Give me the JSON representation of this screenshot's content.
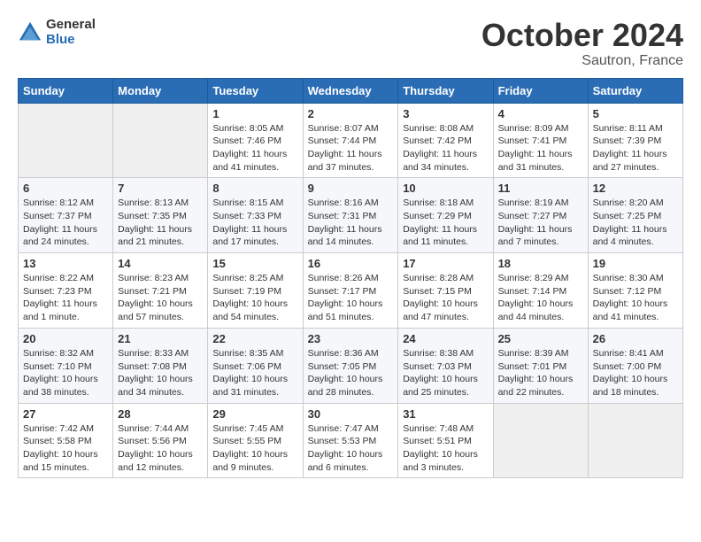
{
  "header": {
    "logo_general": "General",
    "logo_blue": "Blue",
    "month_title": "October 2024",
    "location": "Sautron, France"
  },
  "weekdays": [
    "Sunday",
    "Monday",
    "Tuesday",
    "Wednesday",
    "Thursday",
    "Friday",
    "Saturday"
  ],
  "weeks": [
    [
      {
        "day": "",
        "info": ""
      },
      {
        "day": "",
        "info": ""
      },
      {
        "day": "1",
        "info": "Sunrise: 8:05 AM\nSunset: 7:46 PM\nDaylight: 11 hours and 41 minutes."
      },
      {
        "day": "2",
        "info": "Sunrise: 8:07 AM\nSunset: 7:44 PM\nDaylight: 11 hours and 37 minutes."
      },
      {
        "day": "3",
        "info": "Sunrise: 8:08 AM\nSunset: 7:42 PM\nDaylight: 11 hours and 34 minutes."
      },
      {
        "day": "4",
        "info": "Sunrise: 8:09 AM\nSunset: 7:41 PM\nDaylight: 11 hours and 31 minutes."
      },
      {
        "day": "5",
        "info": "Sunrise: 8:11 AM\nSunset: 7:39 PM\nDaylight: 11 hours and 27 minutes."
      }
    ],
    [
      {
        "day": "6",
        "info": "Sunrise: 8:12 AM\nSunset: 7:37 PM\nDaylight: 11 hours and 24 minutes."
      },
      {
        "day": "7",
        "info": "Sunrise: 8:13 AM\nSunset: 7:35 PM\nDaylight: 11 hours and 21 minutes."
      },
      {
        "day": "8",
        "info": "Sunrise: 8:15 AM\nSunset: 7:33 PM\nDaylight: 11 hours and 17 minutes."
      },
      {
        "day": "9",
        "info": "Sunrise: 8:16 AM\nSunset: 7:31 PM\nDaylight: 11 hours and 14 minutes."
      },
      {
        "day": "10",
        "info": "Sunrise: 8:18 AM\nSunset: 7:29 PM\nDaylight: 11 hours and 11 minutes."
      },
      {
        "day": "11",
        "info": "Sunrise: 8:19 AM\nSunset: 7:27 PM\nDaylight: 11 hours and 7 minutes."
      },
      {
        "day": "12",
        "info": "Sunrise: 8:20 AM\nSunset: 7:25 PM\nDaylight: 11 hours and 4 minutes."
      }
    ],
    [
      {
        "day": "13",
        "info": "Sunrise: 8:22 AM\nSunset: 7:23 PM\nDaylight: 11 hours and 1 minute."
      },
      {
        "day": "14",
        "info": "Sunrise: 8:23 AM\nSunset: 7:21 PM\nDaylight: 10 hours and 57 minutes."
      },
      {
        "day": "15",
        "info": "Sunrise: 8:25 AM\nSunset: 7:19 PM\nDaylight: 10 hours and 54 minutes."
      },
      {
        "day": "16",
        "info": "Sunrise: 8:26 AM\nSunset: 7:17 PM\nDaylight: 10 hours and 51 minutes."
      },
      {
        "day": "17",
        "info": "Sunrise: 8:28 AM\nSunset: 7:15 PM\nDaylight: 10 hours and 47 minutes."
      },
      {
        "day": "18",
        "info": "Sunrise: 8:29 AM\nSunset: 7:14 PM\nDaylight: 10 hours and 44 minutes."
      },
      {
        "day": "19",
        "info": "Sunrise: 8:30 AM\nSunset: 7:12 PM\nDaylight: 10 hours and 41 minutes."
      }
    ],
    [
      {
        "day": "20",
        "info": "Sunrise: 8:32 AM\nSunset: 7:10 PM\nDaylight: 10 hours and 38 minutes."
      },
      {
        "day": "21",
        "info": "Sunrise: 8:33 AM\nSunset: 7:08 PM\nDaylight: 10 hours and 34 minutes."
      },
      {
        "day": "22",
        "info": "Sunrise: 8:35 AM\nSunset: 7:06 PM\nDaylight: 10 hours and 31 minutes."
      },
      {
        "day": "23",
        "info": "Sunrise: 8:36 AM\nSunset: 7:05 PM\nDaylight: 10 hours and 28 minutes."
      },
      {
        "day": "24",
        "info": "Sunrise: 8:38 AM\nSunset: 7:03 PM\nDaylight: 10 hours and 25 minutes."
      },
      {
        "day": "25",
        "info": "Sunrise: 8:39 AM\nSunset: 7:01 PM\nDaylight: 10 hours and 22 minutes."
      },
      {
        "day": "26",
        "info": "Sunrise: 8:41 AM\nSunset: 7:00 PM\nDaylight: 10 hours and 18 minutes."
      }
    ],
    [
      {
        "day": "27",
        "info": "Sunrise: 7:42 AM\nSunset: 5:58 PM\nDaylight: 10 hours and 15 minutes."
      },
      {
        "day": "28",
        "info": "Sunrise: 7:44 AM\nSunset: 5:56 PM\nDaylight: 10 hours and 12 minutes."
      },
      {
        "day": "29",
        "info": "Sunrise: 7:45 AM\nSunset: 5:55 PM\nDaylight: 10 hours and 9 minutes."
      },
      {
        "day": "30",
        "info": "Sunrise: 7:47 AM\nSunset: 5:53 PM\nDaylight: 10 hours and 6 minutes."
      },
      {
        "day": "31",
        "info": "Sunrise: 7:48 AM\nSunset: 5:51 PM\nDaylight: 10 hours and 3 minutes."
      },
      {
        "day": "",
        "info": ""
      },
      {
        "day": "",
        "info": ""
      }
    ]
  ]
}
